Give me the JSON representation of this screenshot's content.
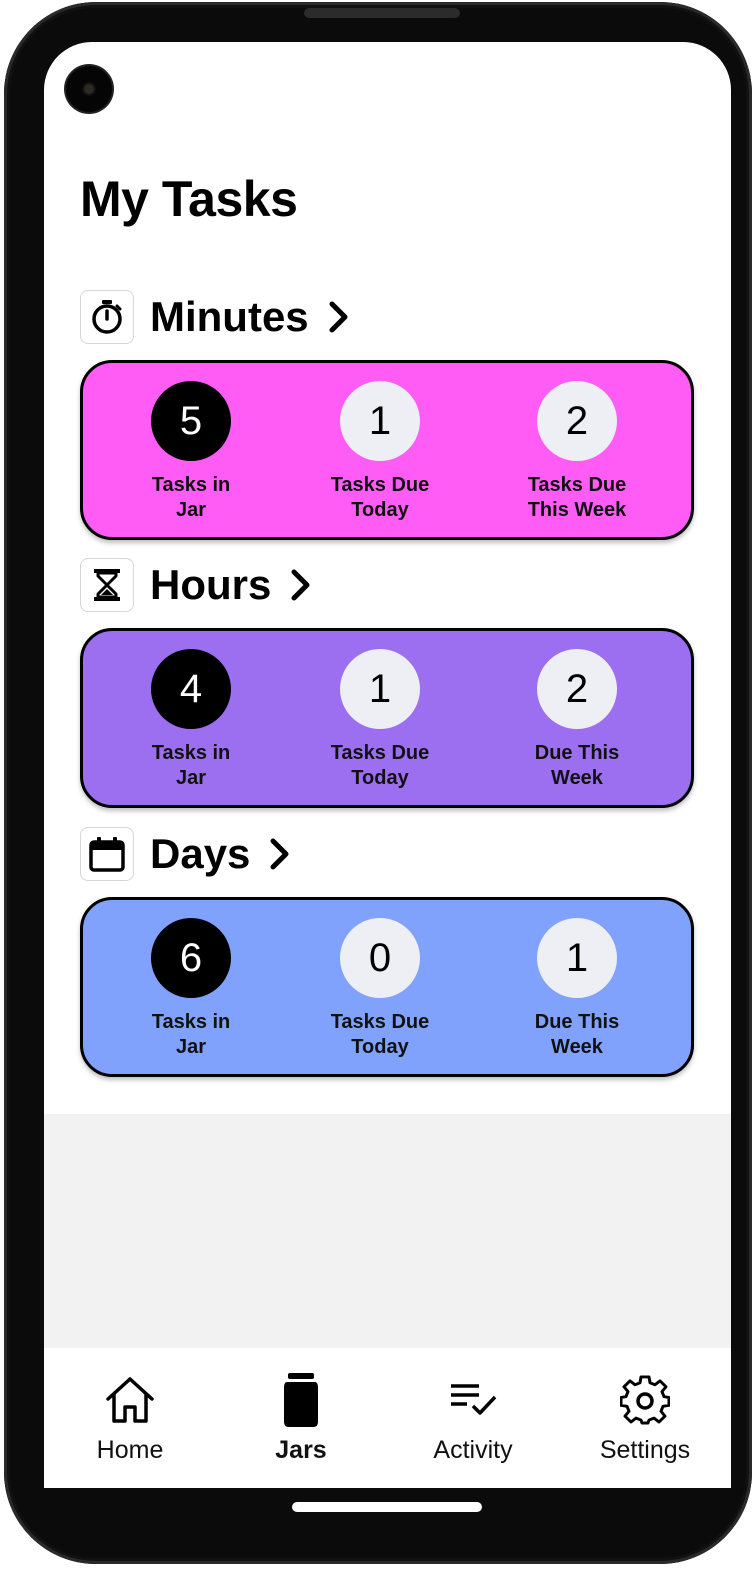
{
  "page": {
    "title": "My Tasks"
  },
  "colors": {
    "minutes_card": "#ff5cf5",
    "hours_card": "#9b6ff0",
    "days_card": "#80a2fc",
    "circle_dark": "#000000",
    "circle_light": "#eeeff5"
  },
  "sections": [
    {
      "label": "Minutes",
      "icon": "stopwatch-icon",
      "stats": [
        {
          "value": "5",
          "label": "Tasks in\nJar"
        },
        {
          "value": "1",
          "label": "Tasks Due\nToday"
        },
        {
          "value": "2",
          "label": "Tasks Due\nThis Week"
        }
      ]
    },
    {
      "label": "Hours",
      "icon": "hourglass-icon",
      "stats": [
        {
          "value": "4",
          "label": "Tasks in\nJar"
        },
        {
          "value": "1",
          "label": "Tasks Due\nToday"
        },
        {
          "value": "2",
          "label": "Due This\nWeek"
        }
      ]
    },
    {
      "label": "Days",
      "icon": "calendar-icon",
      "stats": [
        {
          "value": "6",
          "label": "Tasks in\nJar"
        },
        {
          "value": "0",
          "label": "Tasks Due\nToday"
        },
        {
          "value": "1",
          "label": "Due This\nWeek"
        }
      ]
    }
  ],
  "nav": {
    "items": [
      {
        "label": "Home",
        "icon": "home-icon",
        "active": false
      },
      {
        "label": "Jars",
        "icon": "jar-icon",
        "active": true
      },
      {
        "label": "Activity",
        "icon": "activity-checklist-icon",
        "active": false
      },
      {
        "label": "Settings",
        "icon": "gear-icon",
        "active": false
      }
    ]
  }
}
